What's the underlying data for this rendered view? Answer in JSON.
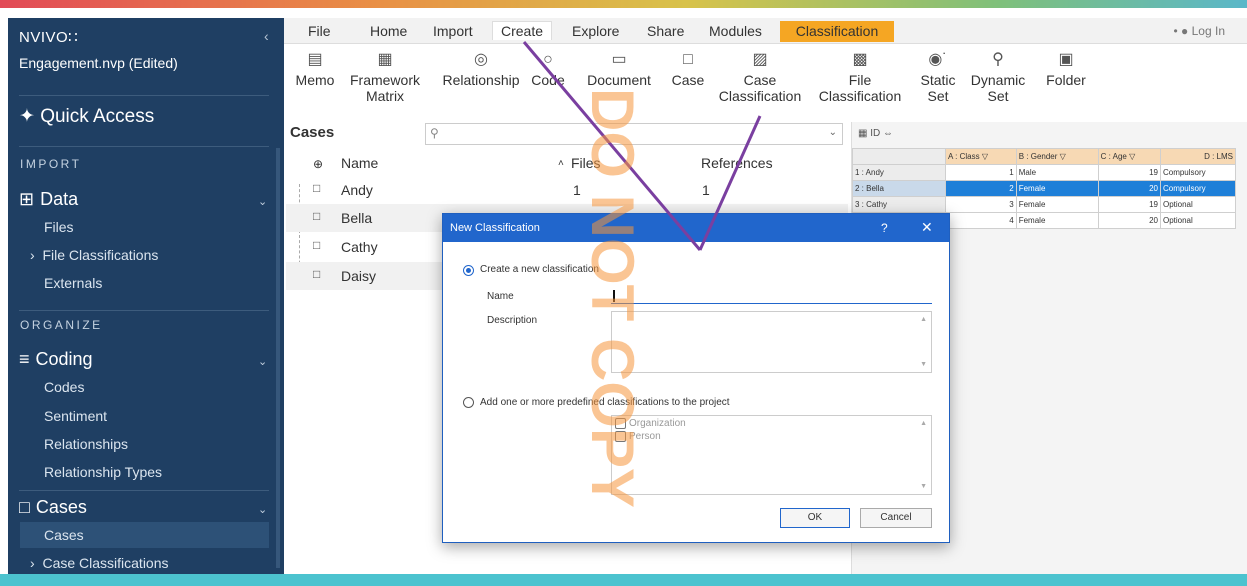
{
  "sidebar": {
    "brand": "NVIVO∷",
    "project": "Engagement.nvp (Edited)",
    "quick_access": "Quick Access",
    "sections": {
      "import": "IMPORT",
      "organize": "ORGANIZE"
    },
    "data_group": "Data",
    "data_items": [
      "Files",
      "File Classifications",
      "Externals"
    ],
    "coding_group": "Coding",
    "coding_items": [
      "Codes",
      "Sentiment",
      "Relationships",
      "Relationship Types"
    ],
    "cases_group": "Cases",
    "cases_items": [
      "Cases",
      "Case Classifications"
    ]
  },
  "tabs": [
    "File",
    "Home",
    "Import",
    "Create",
    "Explore",
    "Share",
    "Modules"
  ],
  "tab_context": "Classification",
  "login": "Log In",
  "ribbon_buttons": [
    {
      "label1": "Memo",
      "label2": "",
      "icon": "memo-icon"
    },
    {
      "label1": "Framework",
      "label2": "Matrix",
      "icon": "framework-matrix-icon"
    },
    {
      "label1": "Relationship",
      "label2": "",
      "icon": "relationship-icon"
    },
    {
      "label1": "Code",
      "label2": "",
      "icon": "code-icon"
    },
    {
      "label1": "Document",
      "label2": "",
      "icon": "document-icon"
    },
    {
      "label1": "Case",
      "label2": "",
      "icon": "case-icon"
    },
    {
      "label1": "Case",
      "label2": "Classification",
      "icon": "case-classification-icon"
    },
    {
      "label1": "File",
      "label2": "Classification",
      "icon": "file-classification-icon"
    },
    {
      "label1": "Static",
      "label2": "Set",
      "icon": "static-set-icon"
    },
    {
      "label1": "Dynamic",
      "label2": "Set",
      "icon": "dynamic-set-icon"
    },
    {
      "label1": "Folder",
      "label2": "",
      "icon": "folder-icon"
    }
  ],
  "cases_list": {
    "title": "Cases",
    "columns": {
      "name": "Name",
      "files": "Files",
      "references": "References"
    },
    "rows": [
      {
        "name": "Andy",
        "files": "1",
        "references": "1"
      },
      {
        "name": "Bella",
        "files": "",
        "references": ""
      },
      {
        "name": "Cathy",
        "files": "",
        "references": ""
      },
      {
        "name": "Daisy",
        "files": "",
        "references": ""
      }
    ]
  },
  "sheet": {
    "toolbar": "ID",
    "headers": [
      "A : Class",
      "B : Gender",
      "C : Age",
      "D : LMS"
    ],
    "rows": [
      {
        "label": "1 : Andy",
        "cls": "1",
        "gender": "Male",
        "age": "19",
        "lms": "Compulsory"
      },
      {
        "label": "2 : Bella",
        "cls": "2",
        "gender": "Female",
        "age": "20",
        "lms": "Compulsory"
      },
      {
        "label": "3 : Cathy",
        "cls": "3",
        "gender": "Female",
        "age": "19",
        "lms": "Optional"
      },
      {
        "label": "",
        "cls": "4",
        "gender": "Female",
        "age": "20",
        "lms": "Optional"
      }
    ]
  },
  "dialog": {
    "title": "New Classification",
    "help": "?",
    "close": "✕",
    "option_create": "Create a new classification",
    "name_label": "Name",
    "description_label": "Description",
    "option_predefined": "Add one or more predefined classifications to the project",
    "predefined": [
      "Organization",
      "Person"
    ],
    "ok": "OK",
    "cancel": "Cancel"
  },
  "watermark": "DO NOT COPY",
  "colors": {
    "sidebar": "#1f3f63",
    "accent": "#2166cc",
    "context_tab": "#f5a623",
    "annotation": "#7a3fa0",
    "selection": "#1e7fd8"
  }
}
